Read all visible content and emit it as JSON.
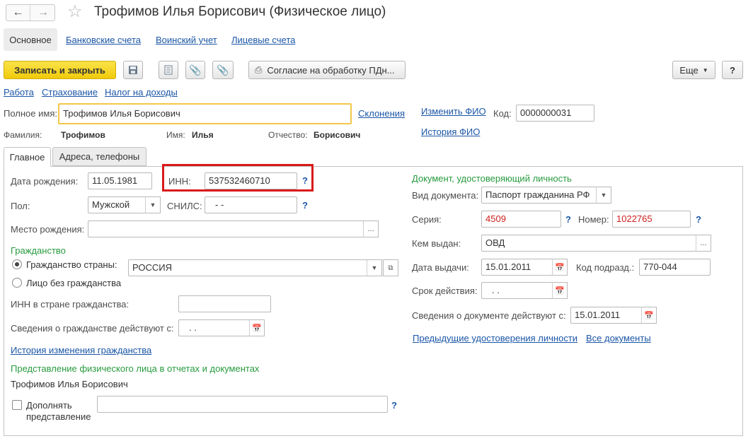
{
  "window": {
    "title": "Трофимов Илья Борисович (Физическое лицо)"
  },
  "nav_tabs": [
    "Основное",
    "Банковские счета",
    "Воинский учет",
    "Лицевые счета"
  ],
  "toolbar": {
    "save_close": "Записать и закрыть",
    "consent": "Согласие на обработку ПДн...",
    "more": "Еще",
    "help": "?"
  },
  "links_row": [
    "Работа",
    "Страхование",
    "Налог на доходы"
  ],
  "header": {
    "full_name_label": "Полное имя:",
    "full_name_value": "Трофимов Илья Борисович",
    "declensions": "Склонения",
    "change_fio": "Изменить ФИО",
    "history_fio": "История ФИО",
    "code_label": "Код:",
    "code_value": "0000000031",
    "surname_label": "Фамилия:",
    "surname_value": "Трофимов",
    "name_label": "Имя:",
    "name_value": "Илья",
    "patronymic_label": "Отчество:",
    "patronymic_value": "Борисович"
  },
  "form_tabs": [
    "Главное",
    "Адреса, телефоны"
  ],
  "main": {
    "birth_date_label": "Дата рождения:",
    "birth_date_value": "11.05.1981",
    "inn_label": "ИНН:",
    "inn_value": "537532460710",
    "gender_label": "Пол:",
    "gender_value": "Мужской",
    "snils_label": "СНИЛС:",
    "snils_value": "-   -",
    "birthplace_label": "Место рождения:",
    "citizenship_header": "Гражданство",
    "radio_country": "Гражданство страны:",
    "country_value": "РОССИЯ",
    "radio_stateless": "Лицо без гражданства",
    "inn_citizenship_label": "ИНН в стране гражданства:",
    "citizenship_valid_label": "Сведения о гражданстве действуют с:",
    "citizenship_valid_value": ".   .",
    "citizenship_history": "История изменения гражданства",
    "representation_header": "Представление физического лица в отчетах и документах",
    "representation_value": "Трофимов Илья Борисович",
    "supplement_label_1": "Дополнять",
    "supplement_label_2": "представление"
  },
  "doc": {
    "header": "Документ, удостоверяющий личность",
    "type_label": "Вид документа:",
    "type_value": "Паспорт гражданина РФ",
    "series_label": "Серия:",
    "series_value": "4509",
    "number_label": "Номер:",
    "number_value": "1022765",
    "issued_by_label": "Кем выдан:",
    "issued_by_value": "ОВД",
    "issue_date_label": "Дата выдачи:",
    "issue_date_value": "15.01.2011",
    "dept_code_label": "Код подразд.:",
    "dept_code_value": "770-044",
    "validity_label": "Срок действия:",
    "validity_value": ".   .",
    "doc_valid_label": "Сведения о документе действуют с:",
    "doc_valid_value": "15.01.2011",
    "prev_docs": "Предыдущие удостоверения личности",
    "all_docs": "Все документы"
  },
  "colors": {
    "primary_button": "#f4d215",
    "link": "#1b56a6",
    "section_green": "#279a3e",
    "highlight_red": "#d91a1a",
    "focused_field": "#f3c64a"
  }
}
